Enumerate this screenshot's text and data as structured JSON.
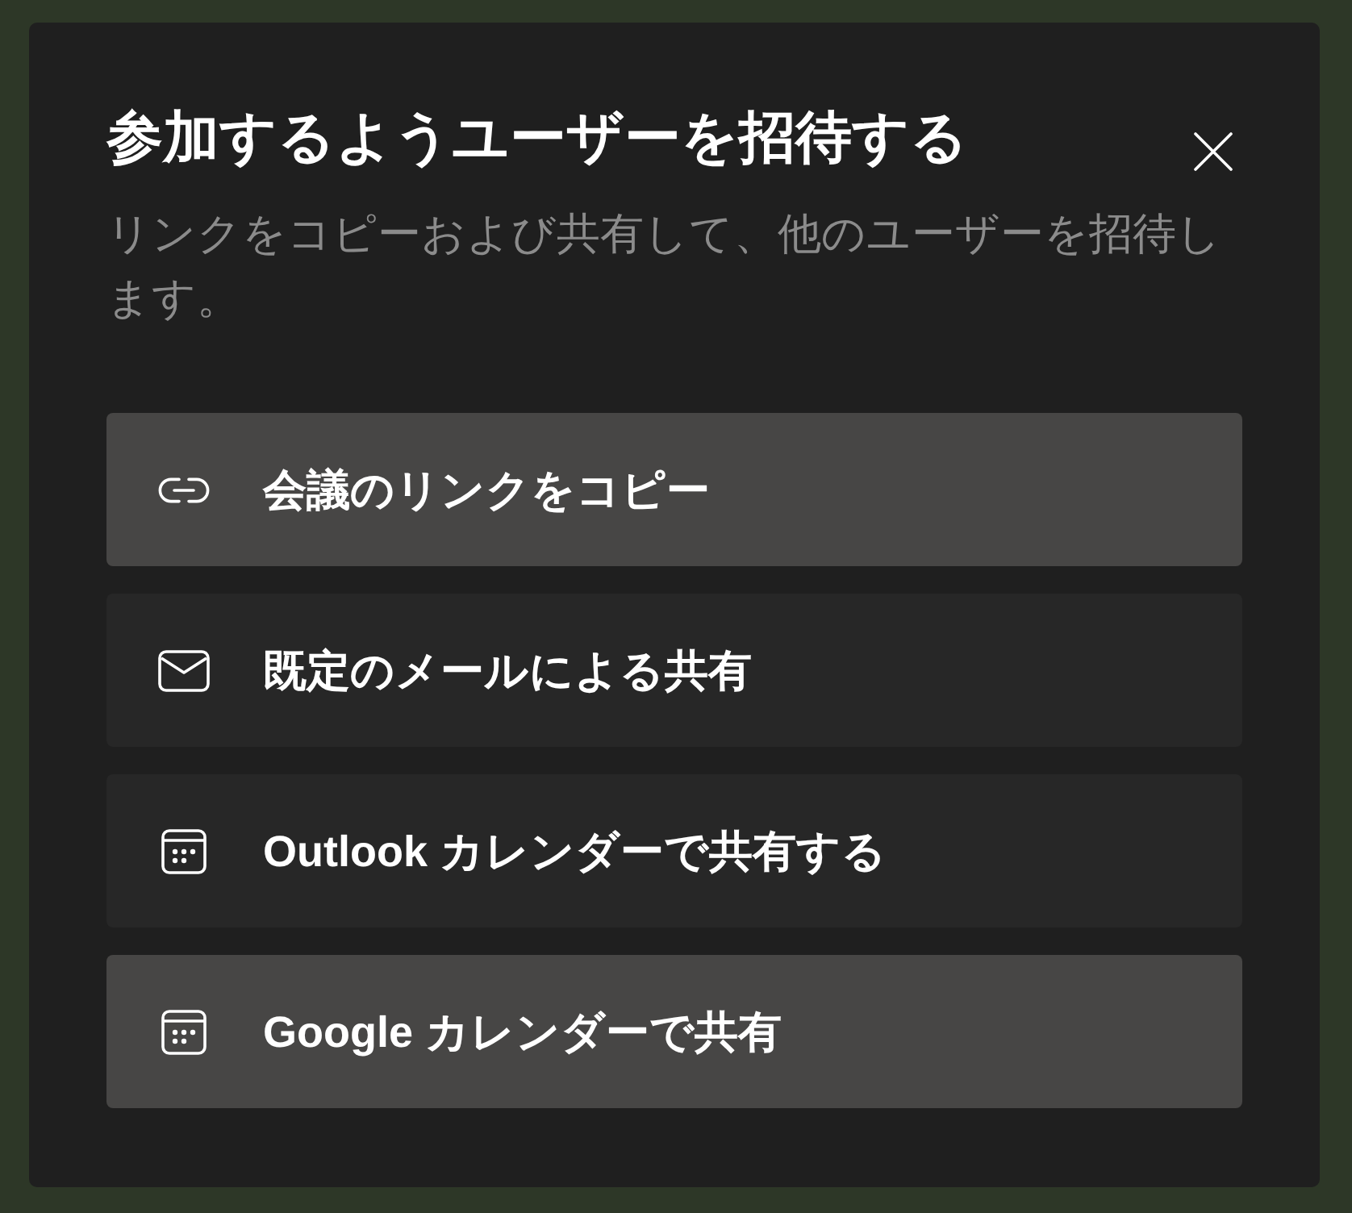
{
  "dialog": {
    "title": "参加するようユーザーを招待する",
    "subtitle": "リンクをコピーおよび共有して、他のユーザーを招待します。",
    "options": [
      {
        "kind": "link",
        "label": "会議のリンクをコピー",
        "highlighted": true
      },
      {
        "kind": "mail",
        "label": "既定のメールによる共有",
        "highlighted": false
      },
      {
        "kind": "calendar",
        "label": "Outlook カレンダーで共有する",
        "highlighted": false
      },
      {
        "kind": "calendar",
        "label": "Google カレンダーで共有",
        "highlighted": true
      }
    ]
  }
}
